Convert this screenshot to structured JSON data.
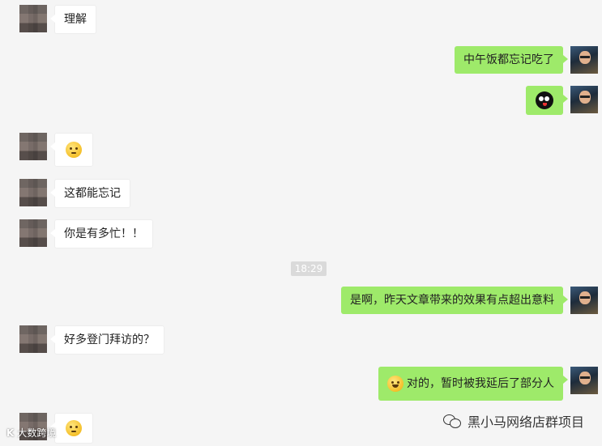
{
  "messages": [
    {
      "side": "left",
      "text": "理解"
    },
    {
      "side": "right",
      "text": "中午饭都忘记吃了"
    },
    {
      "side": "right",
      "sticker": "black-bird-sticker"
    },
    {
      "side": "left",
      "emoji": "pleading-face-emoji"
    },
    {
      "side": "left",
      "text": "这都能忘记"
    },
    {
      "side": "left",
      "text": "你是有多忙！！"
    },
    {
      "side": "right",
      "text": "是啊，昨天文章带来的效果有点超出意料"
    },
    {
      "side": "left",
      "text": "好多登门拜访的？"
    },
    {
      "side": "right",
      "emoji": "laughing-tears-emoji",
      "text": "对的，暂时被我延后了部分人"
    },
    {
      "side": "left",
      "emoji": "pleading-face-emoji"
    }
  ],
  "timestamp": "18:29",
  "watermark_right": "黑小马网络店群项目",
  "watermark_left": "大数跨境",
  "colors": {
    "background": "#f5f5f5",
    "self_bubble": "#9eea6a",
    "other_bubble": "#ffffff",
    "time_badge": "#dadada"
  }
}
